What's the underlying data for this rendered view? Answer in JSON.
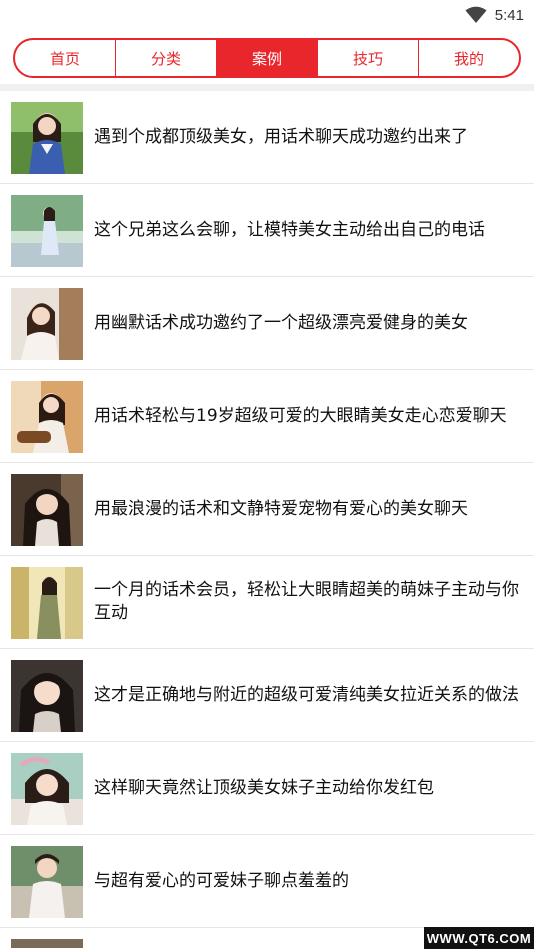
{
  "status": {
    "time": "5:41",
    "wifi_icon": "wifi-icon"
  },
  "tabs": [
    {
      "label": "首页",
      "active": false
    },
    {
      "label": "分类",
      "active": false
    },
    {
      "label": "案例",
      "active": true
    },
    {
      "label": "技巧",
      "active": false
    },
    {
      "label": "我的",
      "active": false
    }
  ],
  "colors": {
    "accent": "#e8262b",
    "divider": "#e6e6e6",
    "gap": "#f0f0f0"
  },
  "articles": [
    {
      "title": "遇到个成都顶级美女，用话术聊天成功邀约出来了"
    },
    {
      "title": " 这个兄弟这么会聊，让模特美女主动给出自己的电话"
    },
    {
      "title": "用幽默话术成功邀约了一个超级漂亮爱健身的美女"
    },
    {
      "title": "用话术轻松与19岁超级可爱的大眼睛美女走心恋爱聊天"
    },
    {
      "title": "用最浪漫的话术和文静特爱宠物有爱心的美女聊天"
    },
    {
      "title": "一个月的话术会员，轻松让大眼睛超美的萌妹子主动与你互动"
    },
    {
      "title": "这才是正确地与附近的超级可爱清纯美女拉近关系的做法"
    },
    {
      "title": "这样聊天竟然让顶级美女妹子主动给你发红包"
    },
    {
      "title": "与超有爱心的可爱妹子聊点羞羞的"
    }
  ],
  "watermark": "WWW.QT6.COM"
}
